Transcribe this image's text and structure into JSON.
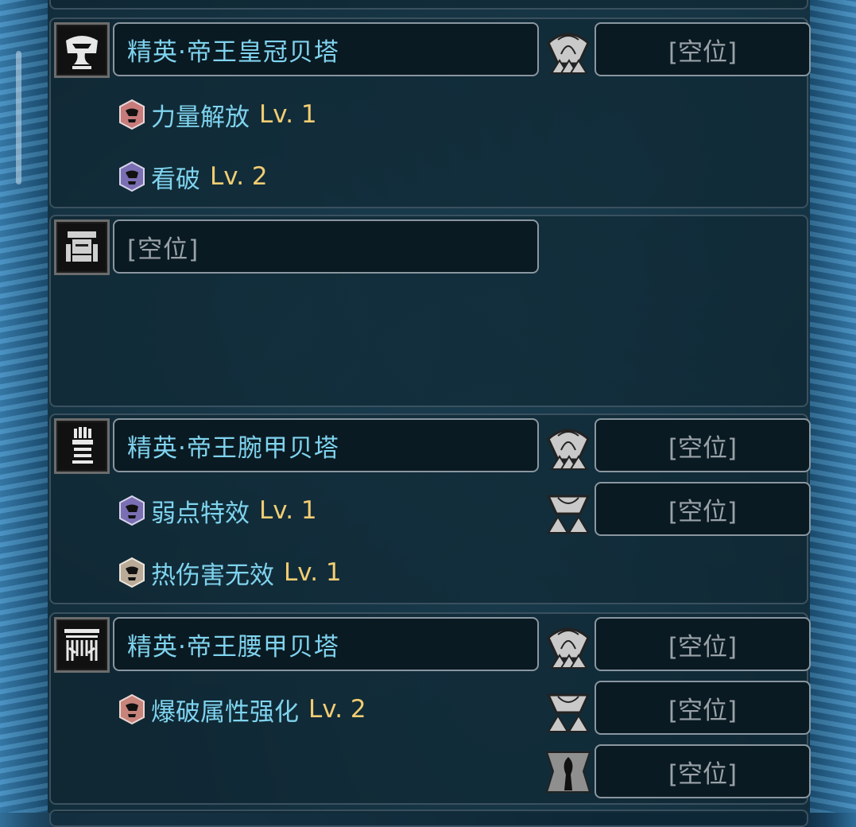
{
  "empty_slot_label": "[空位]",
  "panels": [
    {
      "icon": "helm-icon",
      "name": "精英·帝王皇冠贝塔",
      "skills": [
        {
          "name": "力量解放",
          "level": "Lv. 1",
          "color": "#c77b7b"
        },
        {
          "name": "看破",
          "level": "Lv. 2",
          "color": "#7b6fb4"
        }
      ],
      "slots": [
        {
          "label": "[空位]",
          "size": 3
        }
      ]
    },
    {
      "icon": "chest-armor-icon",
      "name": "[空位]",
      "skills": [],
      "slots": []
    },
    {
      "icon": "gauntlet-icon",
      "name": "精英·帝王腕甲贝塔",
      "skills": [
        {
          "name": "弱点特效",
          "level": "Lv. 1",
          "color": "#7b6fb4"
        },
        {
          "name": "热伤害无效",
          "level": "Lv. 1",
          "color": "#b9ab97"
        }
      ],
      "slots": [
        {
          "label": "[空位]",
          "size": 3
        },
        {
          "label": "[空位]",
          "size": 2
        }
      ]
    },
    {
      "icon": "waist-armor-icon",
      "name": "精英·帝王腰甲贝塔",
      "skills": [
        {
          "name": "爆破属性强化",
          "level": "Lv. 2",
          "color": "#c7847b"
        }
      ],
      "slots": [
        {
          "label": "[空位]",
          "size": 3
        },
        {
          "label": "[空位]",
          "size": 2
        },
        {
          "label": "[空位]",
          "size": 1
        }
      ]
    }
  ]
}
